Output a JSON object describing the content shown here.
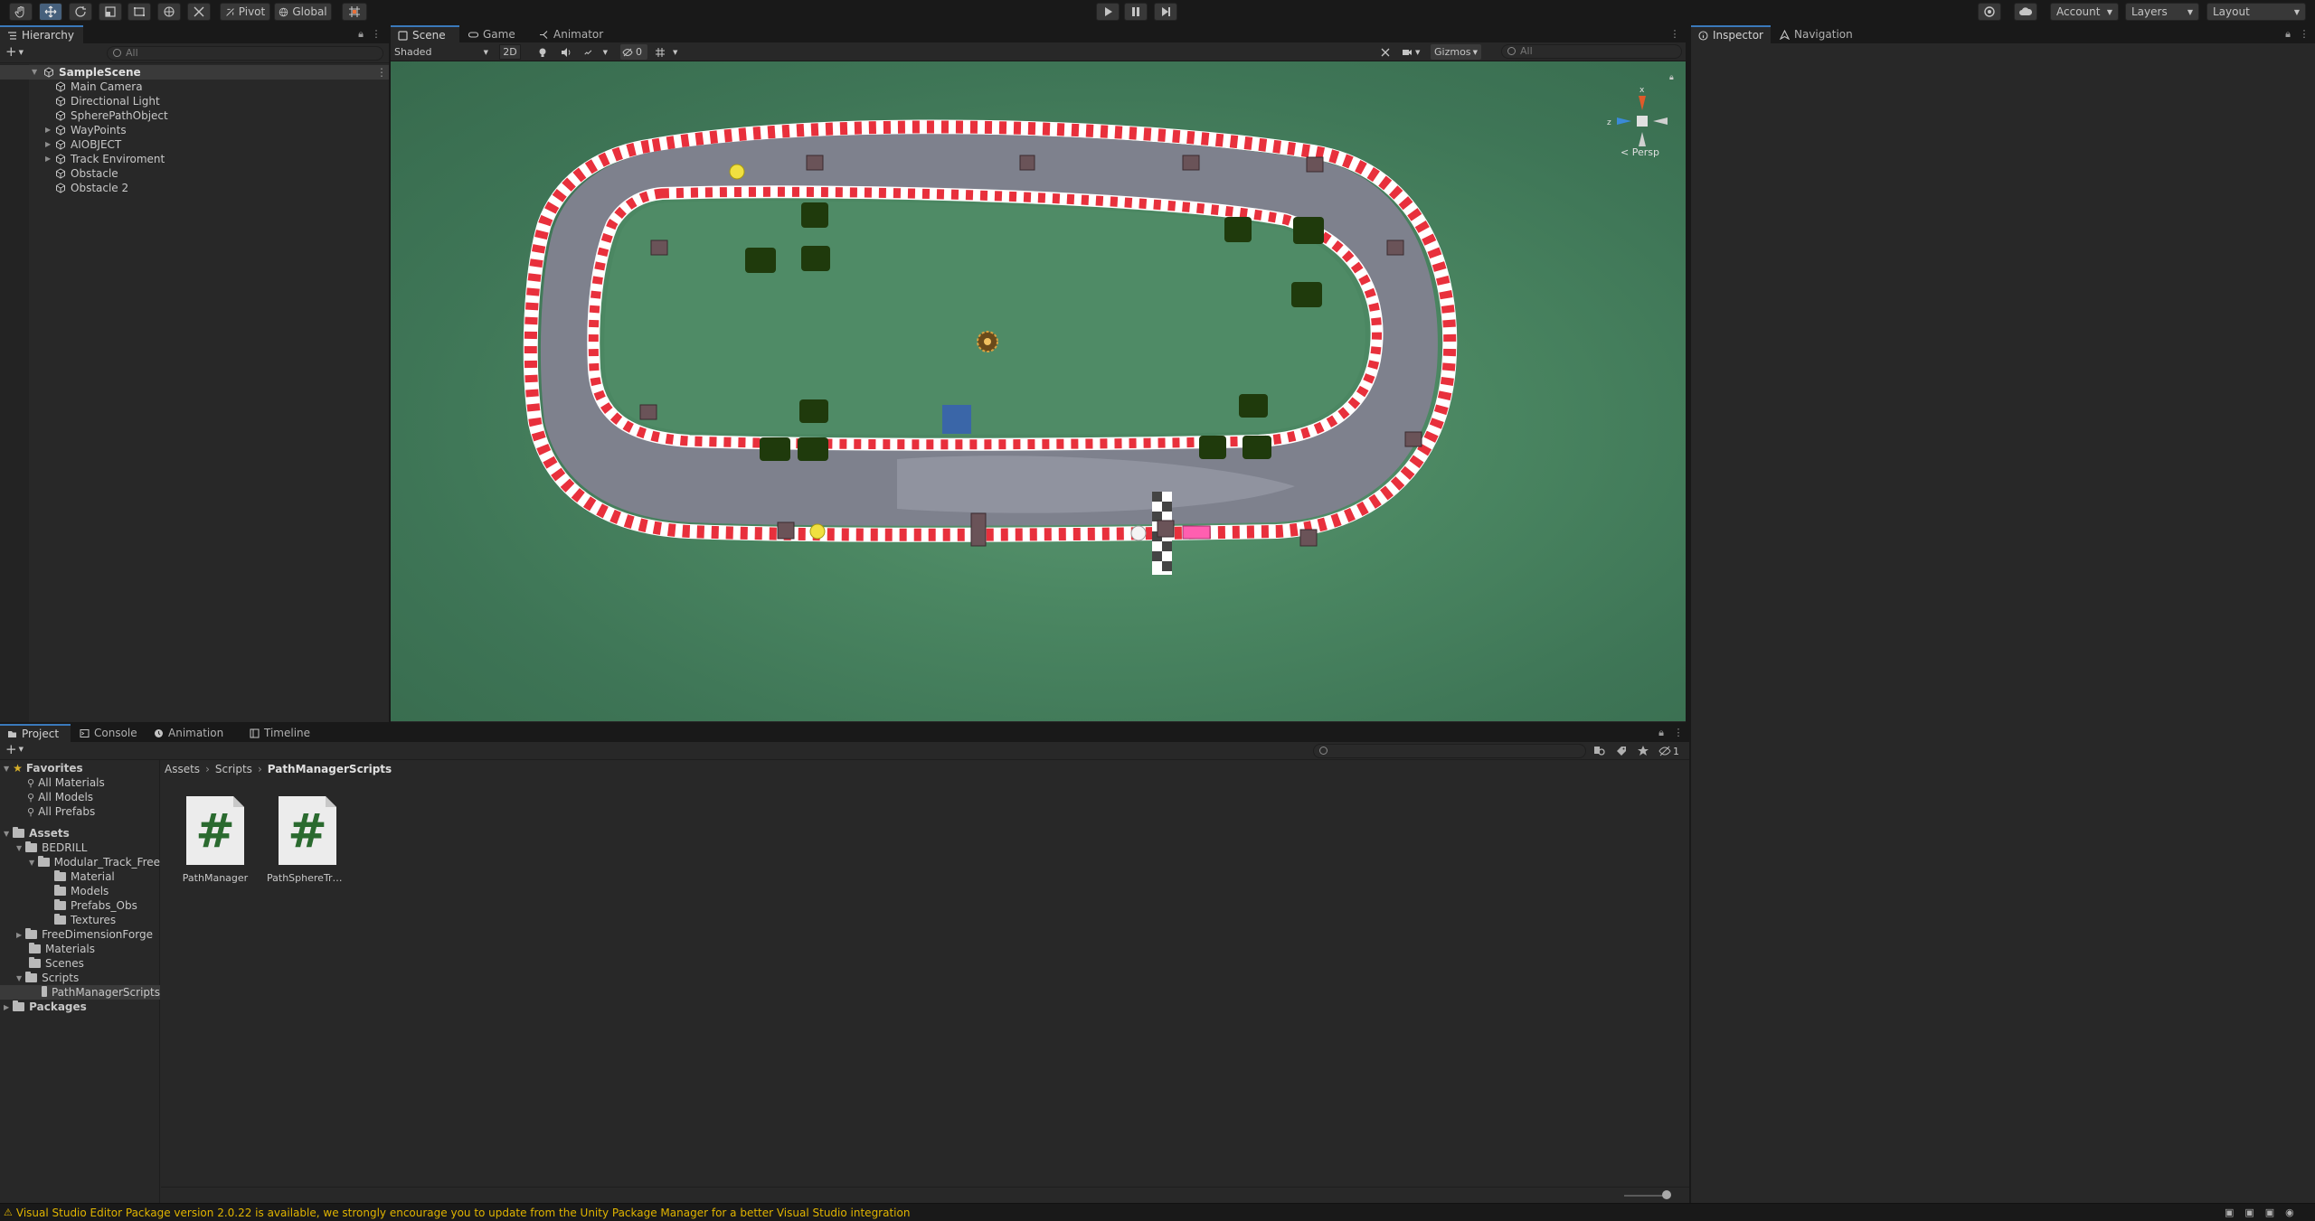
{
  "toolbar": {
    "pivot_label": "Pivot",
    "global_label": "Global",
    "account_label": "Account",
    "layers_label": "Layers",
    "layout_label": "Layout"
  },
  "hierarchy": {
    "tab_label": "Hierarchy",
    "search_placeholder": "All",
    "scene_name": "SampleScene",
    "items": [
      {
        "label": "Main Camera",
        "expandable": false
      },
      {
        "label": "Directional Light",
        "expandable": false
      },
      {
        "label": "SpherePathObject",
        "expandable": false
      },
      {
        "label": "WayPoints",
        "expandable": true
      },
      {
        "label": "AIOBJECT",
        "expandable": true
      },
      {
        "label": "Track Enviroment",
        "expandable": true
      },
      {
        "label": "Obstacle",
        "expandable": false
      },
      {
        "label": "Obstacle 2",
        "expandable": false
      }
    ]
  },
  "scene_view": {
    "tabs": [
      "Scene",
      "Game",
      "Animator"
    ],
    "shading_mode": "Shaded",
    "two_d_label": "2D",
    "hidden_count": "0",
    "gizmos_label": "Gizmos",
    "search_placeholder": "All",
    "projection_label": "< Persp",
    "gizmo_axes": {
      "x": "x",
      "z": "z"
    }
  },
  "inspector": {
    "tabs": [
      "Inspector",
      "Navigation"
    ]
  },
  "project": {
    "tabs": [
      "Project",
      "Console",
      "Animation",
      "Timeline"
    ],
    "visible_count": "1",
    "breadcrumb": [
      "Assets",
      "Scripts",
      "PathManagerScripts"
    ],
    "favorites": {
      "label": "Favorites",
      "items": [
        "All Materials",
        "All Models",
        "All Prefabs"
      ]
    },
    "tree": {
      "assets_label": "Assets",
      "bedrill": "BEDRILL",
      "modular": "Modular_Track_Free",
      "modular_children": [
        "Material",
        "Models",
        "Prefabs_Obs",
        "Textures"
      ],
      "freedim": "FreeDimensionForge",
      "materials": "Materials",
      "scenes": "Scenes",
      "scripts": "Scripts",
      "pathmanager": "PathManagerScripts",
      "packages": "Packages"
    },
    "assets": [
      {
        "name": "PathManager",
        "icon": "csharp-script-icon"
      },
      {
        "name": "PathSphereTrac...",
        "icon": "csharp-script-icon"
      }
    ]
  },
  "status": {
    "message": "Visual Studio Editor Package version 2.0.22 is available, we strongly encourage you to update from the Unity Package Manager for a better Visual Studio integration"
  },
  "colors": {
    "accent": "#3a79bb",
    "warning": "#e0b400",
    "grass": "#4b8762",
    "track": "#7d808c",
    "kerb_red": "#e8303c",
    "script_green": "#2a6a2f"
  }
}
